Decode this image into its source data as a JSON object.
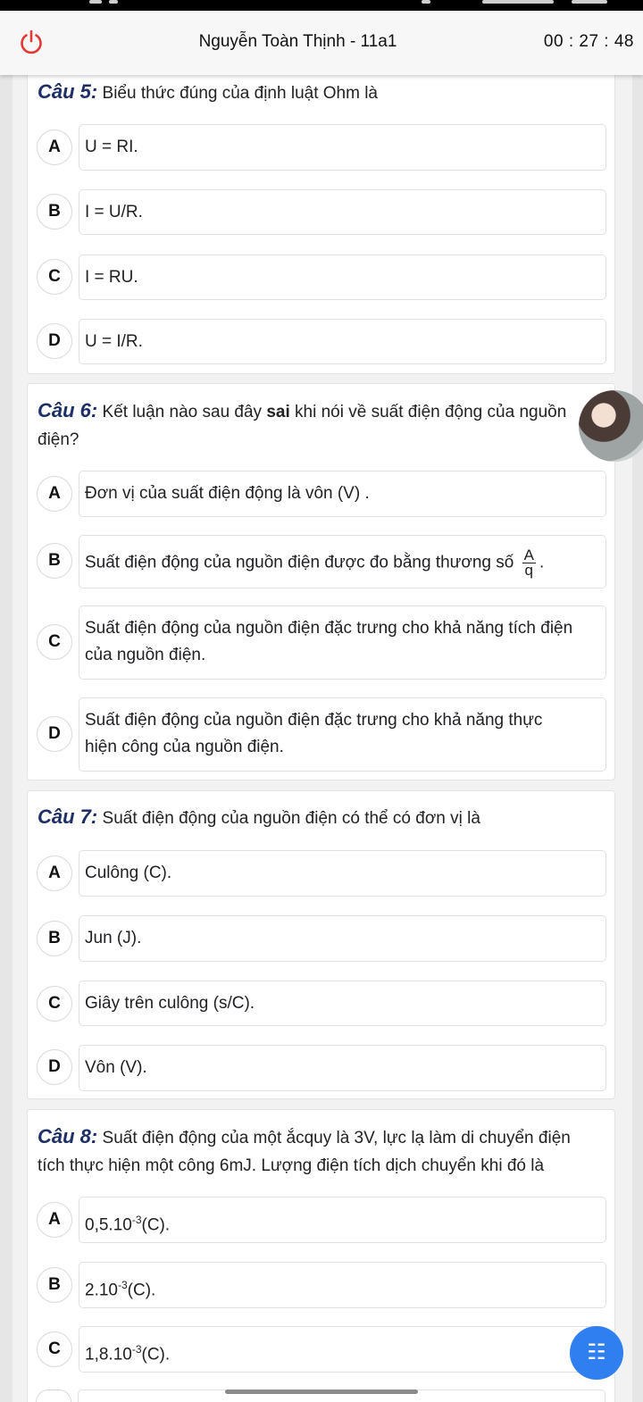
{
  "header": {
    "title": "Nguyễn Toàn Thịnh - 11a1",
    "timer": "00 : 27 : 48"
  },
  "q5": {
    "number": "Câu 5:",
    "text": "Biểu thức đúng của định luật Ohm là",
    "options": [
      {
        "letter": "A",
        "text": "U = RI."
      },
      {
        "letter": "B",
        "text": "I = U/R."
      },
      {
        "letter": "C",
        "text": "I = RU."
      },
      {
        "letter": "D",
        "text": "U = I/R."
      }
    ]
  },
  "q6": {
    "number": "Câu 6:",
    "text_before": "Kết luận nào sau đây",
    "text_bold": "sai",
    "text_after": "khi nói về suất điện động của nguồn",
    "text_line2": "điện?",
    "options": [
      {
        "letter": "A",
        "text": "Đơn vị của suất điện động là vôn (V) ."
      },
      {
        "letter": "B",
        "text": "Suất điện động của nguồn điện được đo bằng thương số",
        "frac_num": "A",
        "frac_den": "q",
        "tail": "."
      },
      {
        "letter": "C",
        "line1": "Suất điện động của nguồn điện đặc trưng cho khả năng tích điện",
        "line2": "của nguồn điện."
      },
      {
        "letter": "D",
        "line1": "Suất điện động của nguồn điện đặc trưng cho khả năng thực",
        "line2": "hiện công của nguồn điện."
      }
    ]
  },
  "q7": {
    "number": "Câu 7:",
    "text": "Suất điện động của nguồn điện có thể có đơn vị là",
    "options": [
      {
        "letter": "A",
        "text": "Culông (C)."
      },
      {
        "letter": "B",
        "text": "Jun (J)."
      },
      {
        "letter": "C",
        "text": "Giây trên culông (s/C)."
      },
      {
        "letter": "D",
        "text": "Vôn (V)."
      }
    ]
  },
  "q8": {
    "number": "Câu 8:",
    "line1": "Suất điện động của một ắcquy là 3V, lực lạ làm di chuyển điện",
    "line2": "tích thực hiện một công 6mJ. Lượng điện tích dịch chuyển khi đó là",
    "options": [
      {
        "letter": "A",
        "base": "0,5.10",
        "exp": "-3",
        "unit": "(C)."
      },
      {
        "letter": "B",
        "base": "2.10",
        "exp": "-3",
        "unit": "(C)."
      },
      {
        "letter": "C",
        "base": "1,8.10",
        "exp": "-3",
        "unit": "(C)."
      }
    ]
  },
  "fab": {
    "icon": "list-icon",
    "glyph": "☷"
  },
  "colors": {
    "question_number": "#1d2f66",
    "fab": "#2f7ff0",
    "power_icon": "#e53935"
  }
}
